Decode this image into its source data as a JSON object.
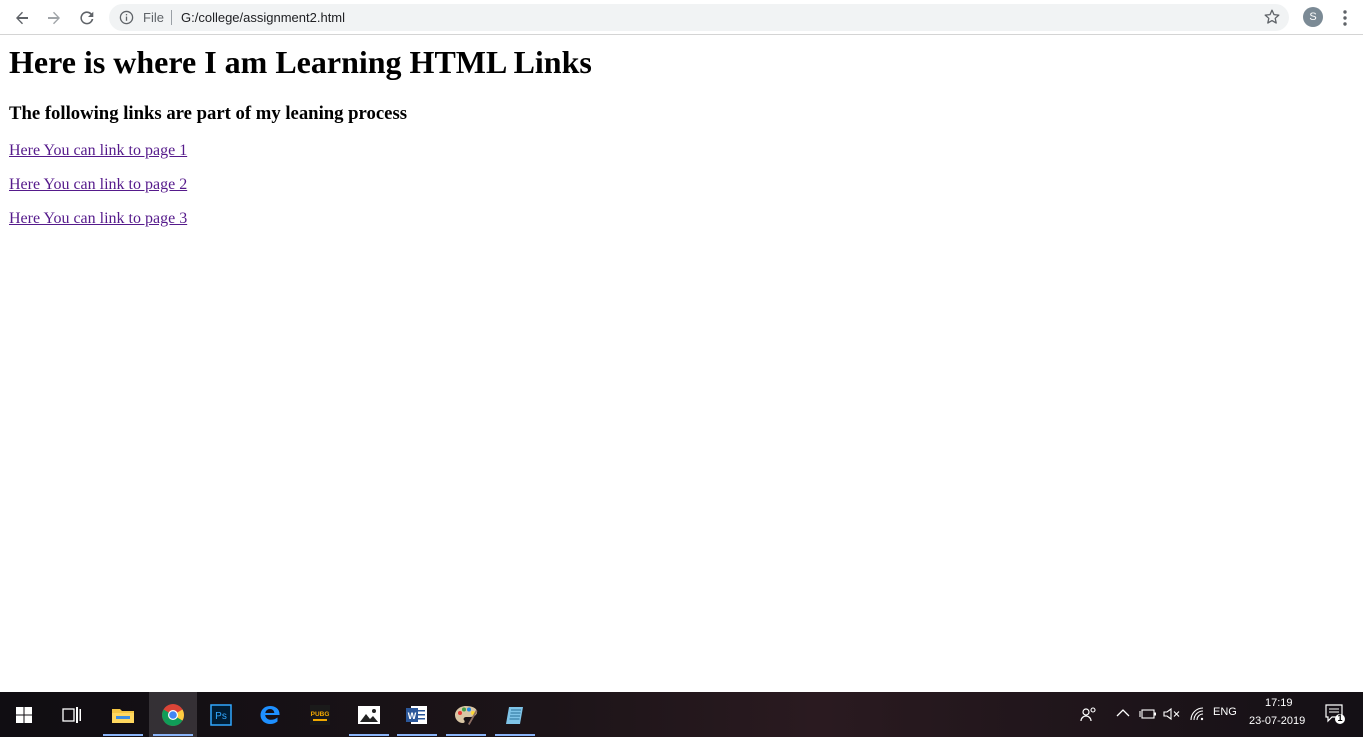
{
  "browser": {
    "scheme_label": "File",
    "url": "G:/college/assignment2.html",
    "profile_initial": "S"
  },
  "page": {
    "heading": "Here is where I am Learning HTML Links",
    "subheading": "The following links are part of my leaning process",
    "links": [
      {
        "label": "Here You can link to page 1"
      },
      {
        "label": "Here You can link to page 2"
      },
      {
        "label": "Here You can link to page 3"
      }
    ]
  },
  "taskbar": {
    "apps": [
      "start-icon",
      "task-view-icon",
      "file-explorer-icon",
      "chrome-icon",
      "photoshop-icon",
      "edge-icon",
      "pubg-icon",
      "photos-icon",
      "word-icon",
      "paint-icon",
      "notepad-icon"
    ],
    "photoshop_label": "Ps",
    "pubg_label": "PUBG",
    "word_label": "W",
    "language": "ENG",
    "time": "17:19",
    "date": "23-07-2019",
    "notification_count": "1"
  },
  "colors": {
    "link_visited": "#551a8b",
    "omnibox_bg": "#f1f3f4"
  }
}
